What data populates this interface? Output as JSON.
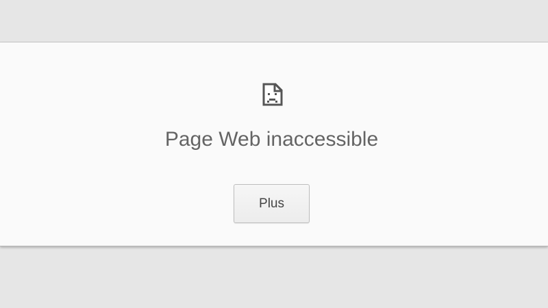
{
  "error": {
    "icon": "broken-page-icon",
    "title": "Page Web inaccessible",
    "more_button_label": "Plus"
  },
  "colors": {
    "background": "#e6e6e6",
    "card": "#fafafa",
    "title_text": "#646464",
    "button_text": "#444444"
  }
}
